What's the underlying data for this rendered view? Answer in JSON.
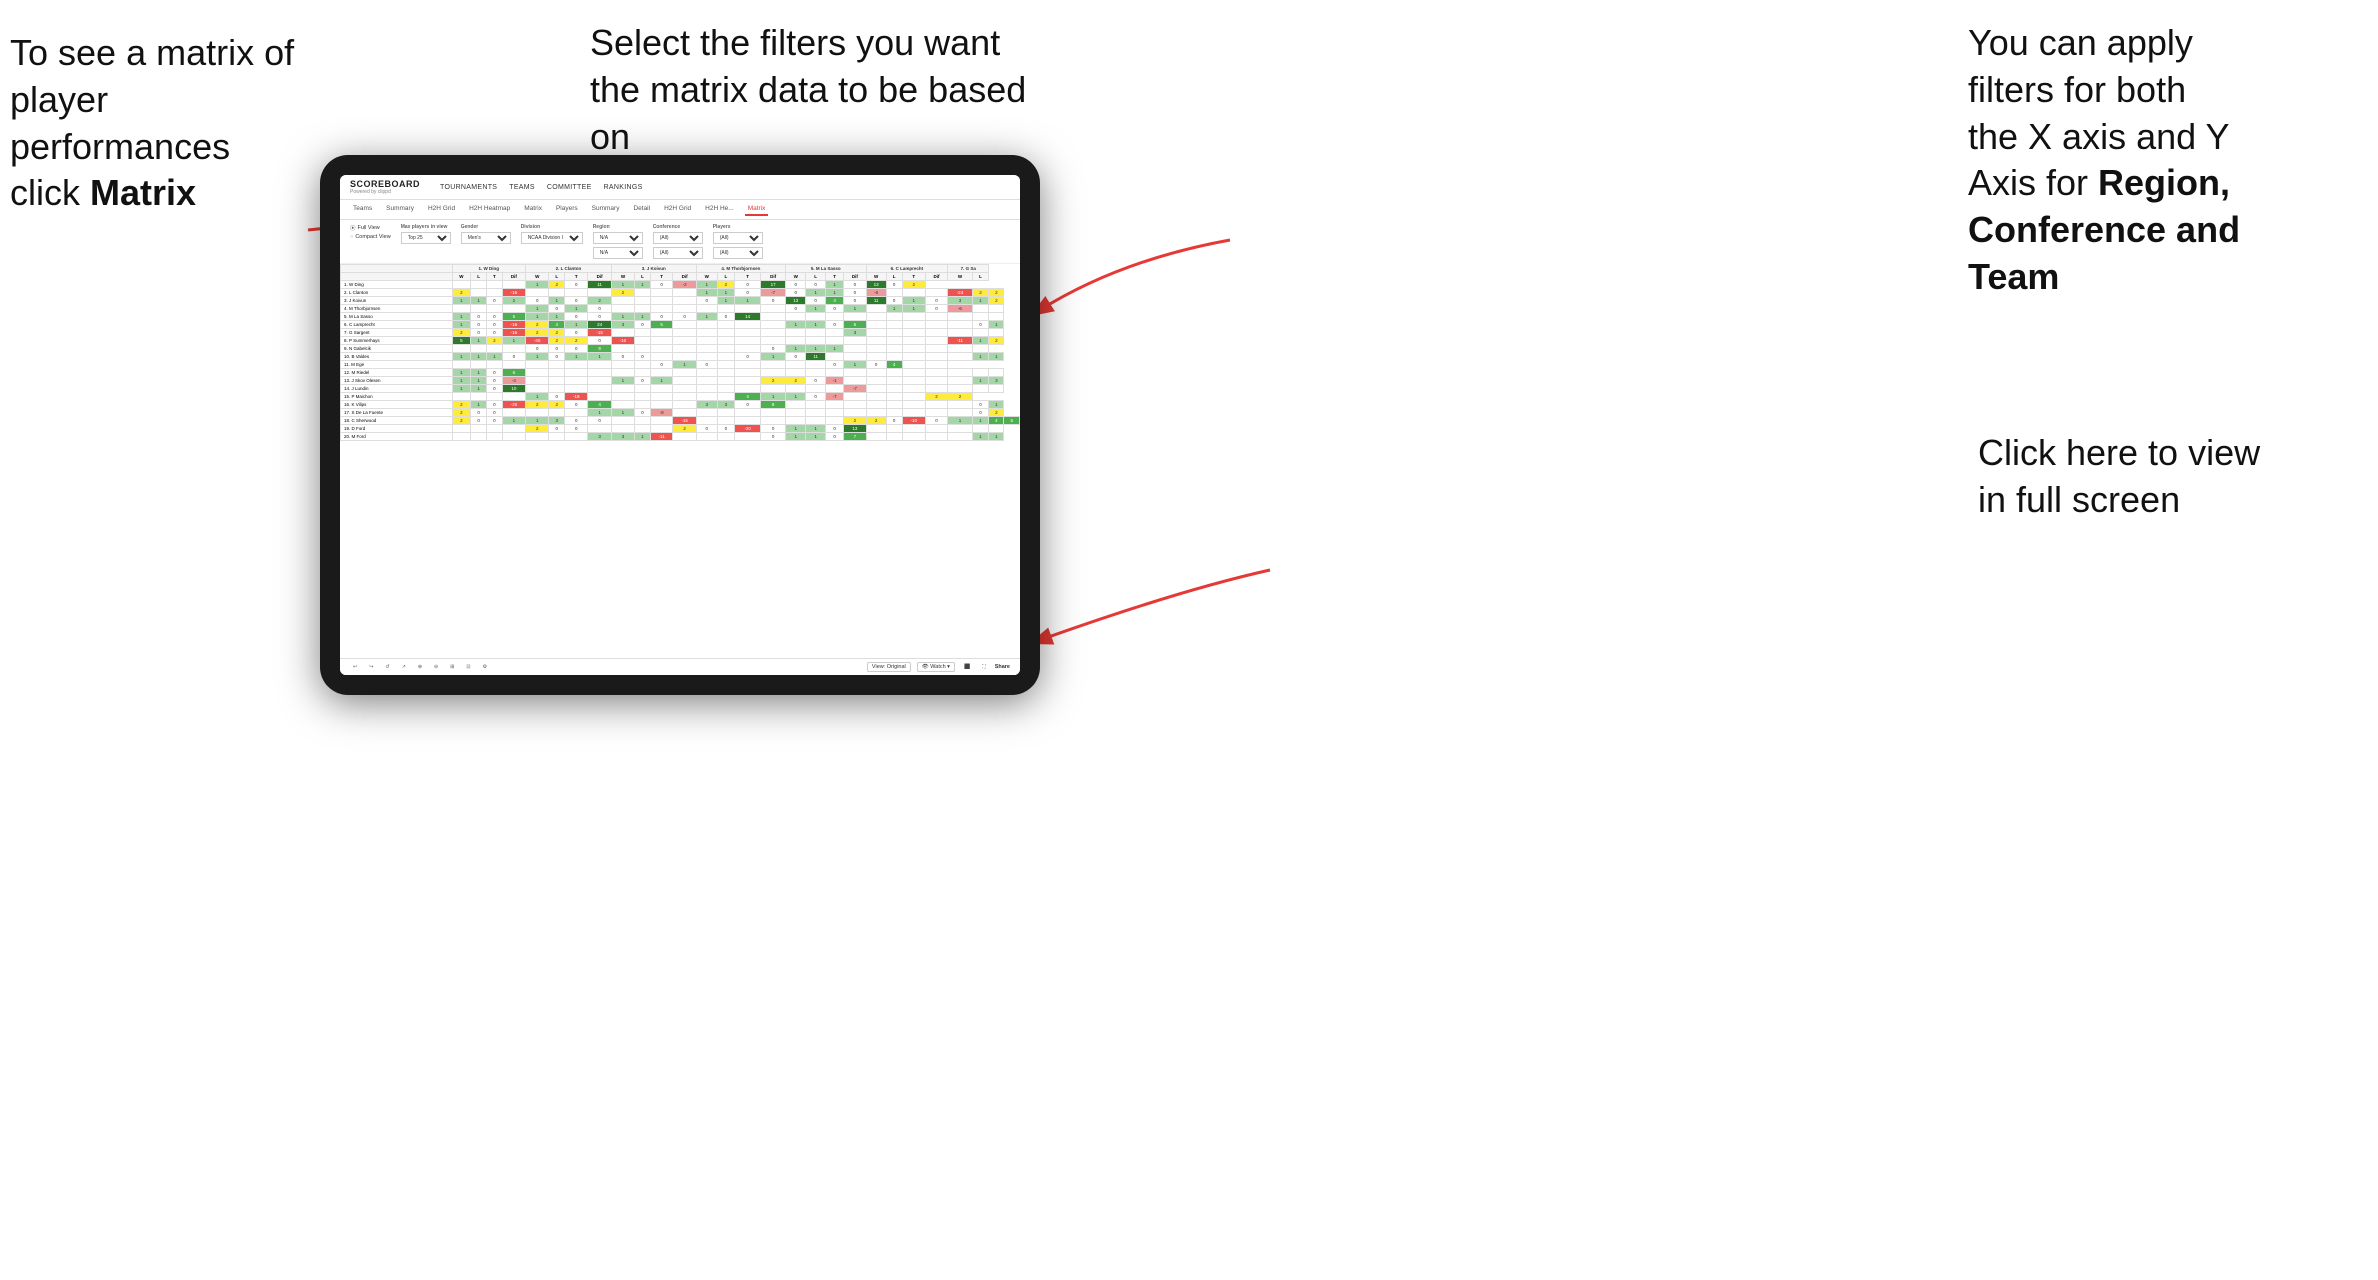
{
  "annotations": {
    "left": {
      "line1": "To see a matrix of",
      "line2": "player performances",
      "line3_plain": "click ",
      "line3_bold": "Matrix"
    },
    "center": {
      "text": "Select the filters you want the matrix data to be based on"
    },
    "right_top": {
      "line1": "You  can apply",
      "line2": "filters for both",
      "line3": "the X axis and Y",
      "line4_plain": "Axis for ",
      "line4_bold": "Region,",
      "line5_bold": "Conference and",
      "line6_bold": "Team"
    },
    "right_bottom": {
      "line1": "Click here to view",
      "line2": "in full screen"
    }
  },
  "tablet": {
    "nav": {
      "logo_title": "SCOREBOARD",
      "logo_sub": "Powered by clippd",
      "items": [
        "TOURNAMENTS",
        "TEAMS",
        "COMMITTEE",
        "RANKINGS"
      ]
    },
    "sub_tabs": [
      "Teams",
      "Summary",
      "H2H Grid",
      "H2H Heatmap",
      "Matrix",
      "Players",
      "Summary",
      "Detail",
      "H2H Grid",
      "H2H He...",
      "Matrix"
    ],
    "active_tab": "Matrix",
    "filters": {
      "view_options": [
        "Full View",
        "Compact View"
      ],
      "active_view": "Full View",
      "max_players_label": "Max players in view",
      "max_players_value": "Top 25",
      "gender_label": "Gender",
      "gender_value": "Men's",
      "division_label": "Division",
      "division_value": "NCAA Division I",
      "region_label": "Region",
      "region_values": [
        "N/A",
        "N/A"
      ],
      "conference_label": "Conference",
      "conference_values": [
        "(All)",
        "(All)"
      ],
      "players_label": "Players",
      "players_values": [
        "(All)",
        "(All)"
      ]
    },
    "column_headers": [
      "1. W Ding",
      "2. L Clanton",
      "3. J Koivun",
      "4. M Thorbjornsen",
      "5. M La Sasso",
      "6. C Lamprecht",
      "7. G Sa"
    ],
    "wlt_headers": [
      "W",
      "L",
      "T",
      "Dif"
    ],
    "players": [
      {
        "name": "1. W Ding"
      },
      {
        "name": "2. L Clanton"
      },
      {
        "name": "3. J Koivun"
      },
      {
        "name": "4. M Thorbjornsen"
      },
      {
        "name": "5. M La Sasso"
      },
      {
        "name": "6. C Lamprecht"
      },
      {
        "name": "7. G Sargent"
      },
      {
        "name": "8. P Summerhays"
      },
      {
        "name": "9. N Gabelcik"
      },
      {
        "name": "10. B Valdes"
      },
      {
        "name": "11. M Ege"
      },
      {
        "name": "12. M Riedel"
      },
      {
        "name": "13. J Skov Olesen"
      },
      {
        "name": "14. J Lundin"
      },
      {
        "name": "15. P Maichon"
      },
      {
        "name": "16. K Vilips"
      },
      {
        "name": "17. S De La Fuente"
      },
      {
        "name": "18. C Sherwood"
      },
      {
        "name": "19. D Ford"
      },
      {
        "name": "20. M Ford"
      }
    ],
    "bottom_bar": {
      "view_label": "View: Original",
      "watch_label": "Watch",
      "share_label": "Share"
    }
  }
}
